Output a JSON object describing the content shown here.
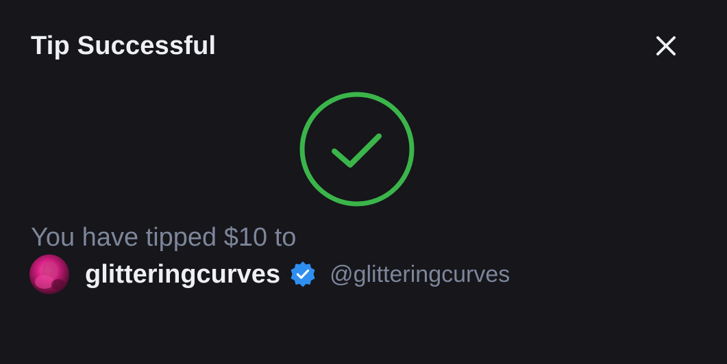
{
  "dialog": {
    "title": "Tip Successful",
    "close_icon": "close-icon",
    "status_icon": "check-circle-icon",
    "message_prefix": "You have tipped",
    "amount": "$10",
    "message_suffix": "to"
  },
  "creator": {
    "display_name": "glitteringcurves",
    "verified_icon": "verified-badge-icon",
    "handle": "@glitteringcurves"
  },
  "colors": {
    "background": "#16161b",
    "success": "#3bb54a",
    "verified": "#2f8ff0",
    "title_text": "#eef0f4",
    "muted_text": "#7d869a"
  }
}
